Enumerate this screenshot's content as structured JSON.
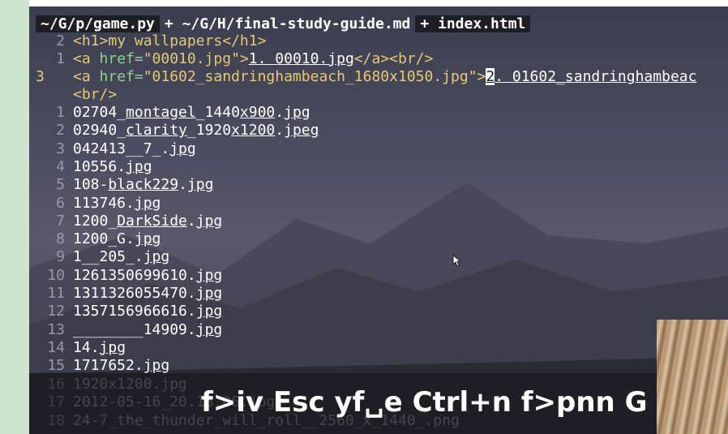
{
  "tabline": {
    "tab1": "~/G/p/game.py",
    "tab2": "+ ~/G/H/final-study-guide.md",
    "tab3": "+ index.html"
  },
  "code": {
    "l1": {
      "num": "2",
      "open": "<h1>",
      "text": "my wallpapers",
      "close": "</h1>"
    },
    "l2": {
      "num": "1",
      "a_open": "<a ",
      "attr": "href=",
      "val": "\"00010.jpg\"",
      "gt": ">",
      "link": "1. 00010.jpg",
      "end": "</a><br/>"
    },
    "l3": {
      "num": "3",
      "a_open": "<a ",
      "attr": "href=",
      "val": "\"01602_sandringhambeach_1680x1050.jpg\"",
      "gt": ">",
      "cursor": "2",
      "link": ". 01602_sandringhambeac"
    },
    "l3b": {
      "text": "<br/>"
    }
  },
  "files": [
    {
      "num": "1",
      "a": "02704_",
      "b": "montagel",
      "c": "_1440",
      "d": "x900",
      "e": ".",
      "f": "jpg"
    },
    {
      "num": "2",
      "a": "02940_",
      "b": "clarity",
      "c": "_1920",
      "d": "x1200",
      "e": ".",
      "f": "jpeg"
    },
    {
      "num": "3",
      "a": "042413__7_",
      "b": "",
      "c": "",
      "d": "",
      "e": ".",
      "f": "jpg"
    },
    {
      "num": "4",
      "a": "10556",
      "b": "",
      "c": "",
      "d": "",
      "e": ".",
      "f": "jpg"
    },
    {
      "num": "5",
      "a": "108-",
      "b": "black229",
      "c": "",
      "d": "",
      "e": ".",
      "f": "jpg"
    },
    {
      "num": "6",
      "a": "113746",
      "b": "",
      "c": "",
      "d": "",
      "e": ".",
      "f": "jpg"
    },
    {
      "num": "7",
      "a": "1200_",
      "b": "DarkSide",
      "c": "",
      "d": "",
      "e": ".",
      "f": "jpg"
    },
    {
      "num": "8",
      "a": "1200_G",
      "b": "",
      "c": "",
      "d": "",
      "e": ".",
      "f": "jpg"
    },
    {
      "num": "9",
      "a": "1__205_",
      "b": "",
      "c": "",
      "d": "",
      "e": ".",
      "f": "jpg"
    },
    {
      "num": "10",
      "a": "1261350699610",
      "b": "",
      "c": "",
      "d": "",
      "e": ".",
      "f": "jpg"
    },
    {
      "num": "11",
      "a": "1311326055470",
      "b": "",
      "c": "",
      "d": "",
      "e": ".",
      "f": "jpg"
    },
    {
      "num": "12",
      "a": "1357156966616",
      "b": "",
      "c": "",
      "d": "",
      "e": ".",
      "f": "jpg"
    },
    {
      "num": "13",
      "a": "________14909",
      "b": "",
      "c": "",
      "d": "",
      "e": ".",
      "f": "jpg"
    },
    {
      "num": "14",
      "a": "14",
      "b": "",
      "c": "",
      "d": "",
      "e": ".",
      "f": "jpg"
    },
    {
      "num": "15",
      "a": "1717652",
      "b": "",
      "c": "",
      "d": "",
      "e": ".",
      "f": "jpg"
    }
  ],
  "faded": [
    {
      "num": "16",
      "text": "1920x1200.jpg"
    },
    {
      "num": "17",
      "text": "2012-05-16_20.16.06.jpg"
    },
    {
      "num": "18",
      "text": "24-7_the_thunder_will_roll__2560_x_1440_.png"
    }
  ],
  "keycast": "f>iv Esc yf␣e Ctrl+n f>pnn G",
  "colors": {
    "tag": "#e8c872",
    "attr": "#8fd18f",
    "linenr": "#9a9aa5",
    "text": "#ffffff"
  }
}
